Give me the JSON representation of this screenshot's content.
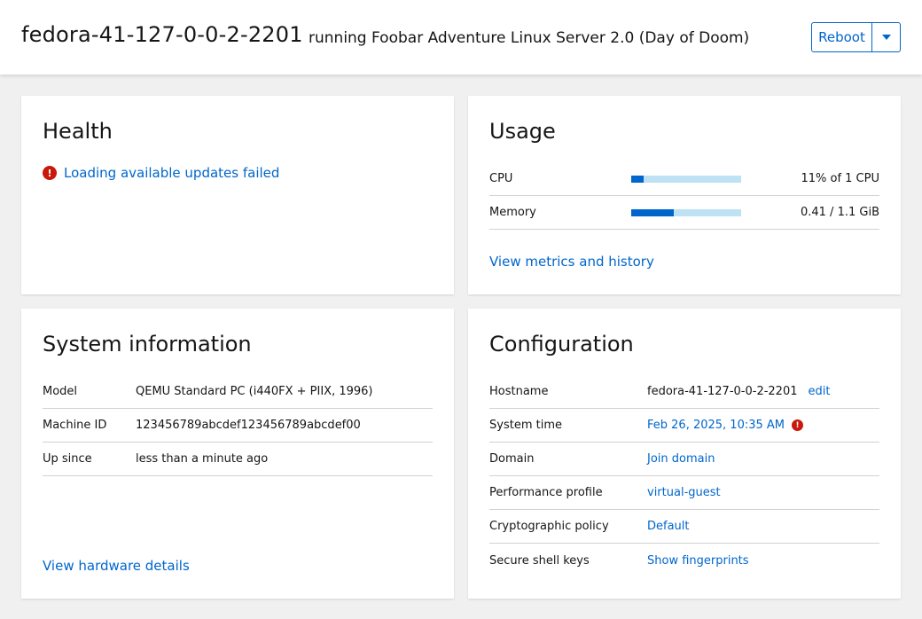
{
  "header": {
    "hostname": "fedora-41-127-0-0-2-2201",
    "os": "running Foobar Adventure Linux Server 2.0 (Day of Doom)",
    "reboot_label": "Reboot"
  },
  "health": {
    "title": "Health",
    "message": "Loading available updates failed",
    "icon": "exclamation-circle-icon"
  },
  "usage": {
    "title": "Usage",
    "rows": [
      {
        "label": "CPU",
        "value": "11% of 1 CPU",
        "fraction": 0.11
      },
      {
        "label": "Memory",
        "value": "0.41 / 1.1 GiB",
        "fraction": 0.39
      }
    ],
    "link": "View metrics and history"
  },
  "system_info": {
    "title": "System information",
    "rows": [
      {
        "key": "Model",
        "value": "QEMU Standard PC (i440FX + PIIX, 1996)"
      },
      {
        "key": "Machine ID",
        "value": "123456789abcdef123456789abcdef00"
      },
      {
        "key": "Up since",
        "value": "less than a minute ago"
      }
    ],
    "link": "View hardware details"
  },
  "configuration": {
    "title": "Configuration",
    "hostname_key": "Hostname",
    "hostname_value": "fedora-41-127-0-0-2-2201",
    "hostname_edit": "edit",
    "time_key": "System time",
    "time_value": "Feb 26, 2025, 10:35 AM",
    "domain_key": "Domain",
    "domain_value": "Join domain",
    "perf_key": "Performance profile",
    "perf_value": "virtual-guest",
    "crypto_key": "Cryptographic policy",
    "crypto_value": "Default",
    "ssh_key": "Secure shell keys",
    "ssh_value": "Show fingerprints"
  },
  "colors": {
    "link": "#0066cc",
    "danger": "#c9190b",
    "bar_track": "#bee1f4",
    "bar_fill": "#0066cc"
  }
}
